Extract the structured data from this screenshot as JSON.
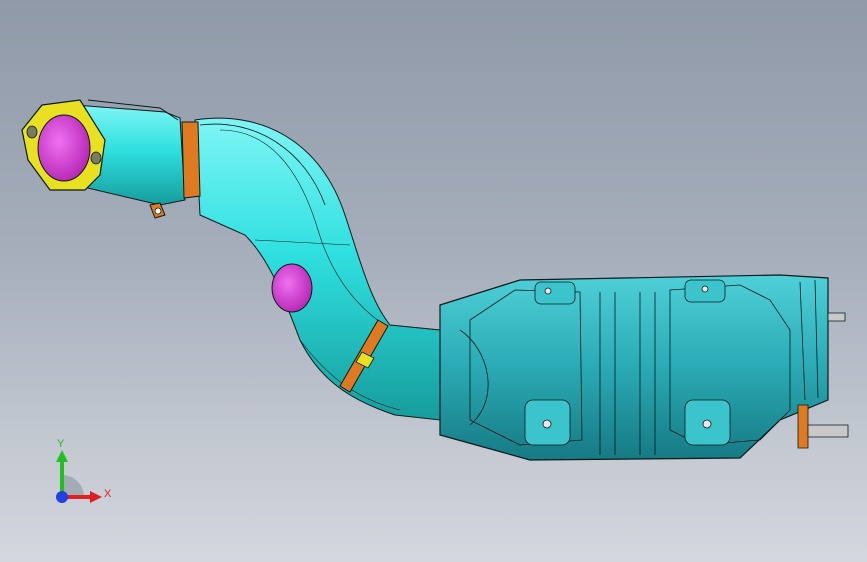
{
  "viewport": {
    "background_top": "#8f9aa8",
    "background_bottom": "#d3d7de"
  },
  "model": {
    "pipe_color": "#2fe0e0",
    "converter_color": "#2fb6c0",
    "flange_color": "#e8e020",
    "inner_color": "#e040e0",
    "clamp_color": "#e07a20",
    "edge_color": "#0a1a1a"
  },
  "triad": {
    "x_label": "X",
    "y_label": "Y",
    "x_color": "#e02020",
    "y_color": "#20c020",
    "z_color": "#2040e0"
  }
}
